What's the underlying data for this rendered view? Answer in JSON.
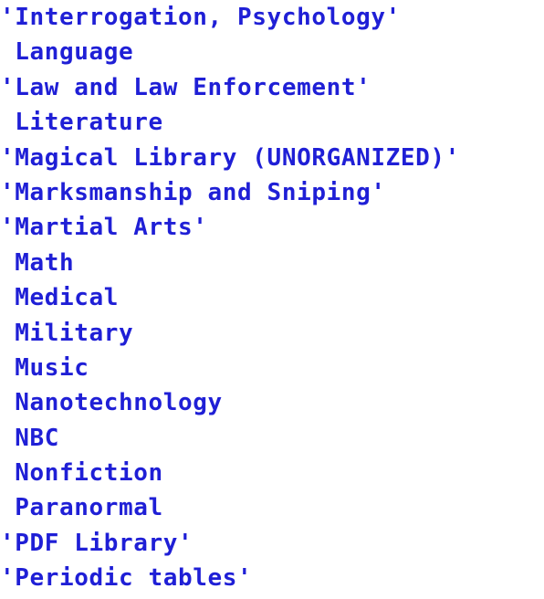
{
  "listing": {
    "entries": [
      "'Interrogation, Psychology'",
      " Language",
      "'Law and Law Enforcement'",
      " Literature",
      "'Magical Library (UNORGANIZED)'",
      "'Marksmanship and Sniping'",
      "'Martial Arts'",
      " Math",
      " Medical",
      " Military",
      " Music",
      " Nanotechnology",
      " NBC",
      " Nonfiction",
      " Paranormal",
      "'PDF Library'",
      "'Periodic tables'"
    ],
    "text_color": "#1f1fd6",
    "background_color": "#ffffff"
  }
}
